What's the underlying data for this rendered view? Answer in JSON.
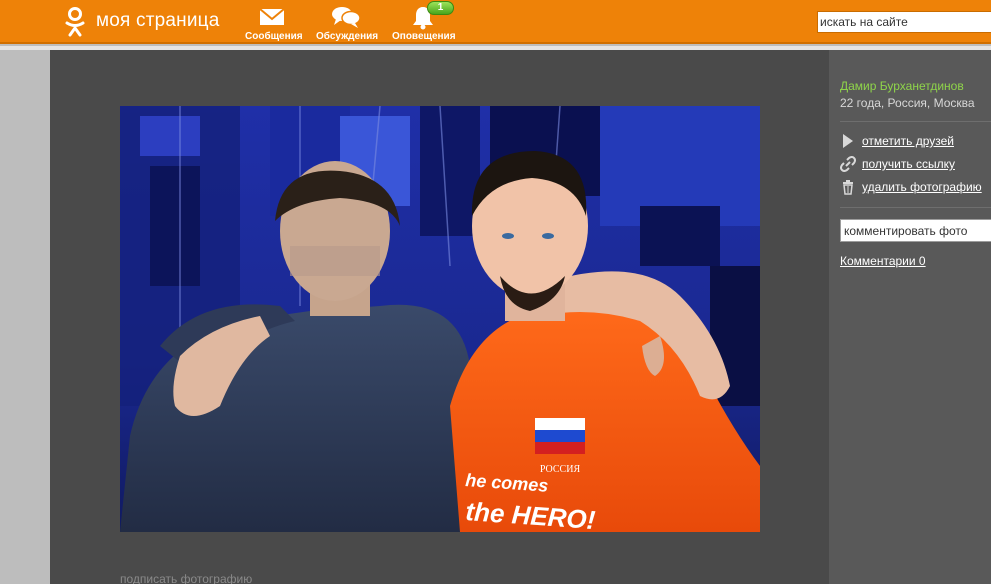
{
  "header": {
    "logo_text": "моя страница",
    "nav": [
      {
        "label": "Сообщения",
        "icon": "envelope-icon"
      },
      {
        "label": "Обсуждения",
        "icon": "chat-bubbles-icon"
      },
      {
        "label": "Оповещения",
        "icon": "bell-icon",
        "badge": "1"
      }
    ],
    "search_placeholder": "искать на сайте"
  },
  "photo": {
    "shirt_flag_text": "РОССИЯ",
    "shirt_text_line1": "he comes",
    "shirt_text_line2": "the HERO!",
    "caption_link": "подписать фотографию"
  },
  "sidebar": {
    "owner_name": "Дамир Бурханетдинов",
    "owner_info": "22 года, Россия, Москва",
    "actions": [
      {
        "label": "отметить друзей",
        "icon": "cursor-icon"
      },
      {
        "label": "получить ссылку",
        "icon": "link-icon"
      },
      {
        "label": "удалить фотографию",
        "icon": "trash-icon"
      }
    ],
    "comment_placeholder": "комментировать фото",
    "comments_link": "Комментарии 0"
  },
  "colors": {
    "brand_orange": "#ee8208",
    "owner_green": "#8fd44a",
    "stage_bg": "#4a4a4a",
    "side_bg": "#595959"
  }
}
